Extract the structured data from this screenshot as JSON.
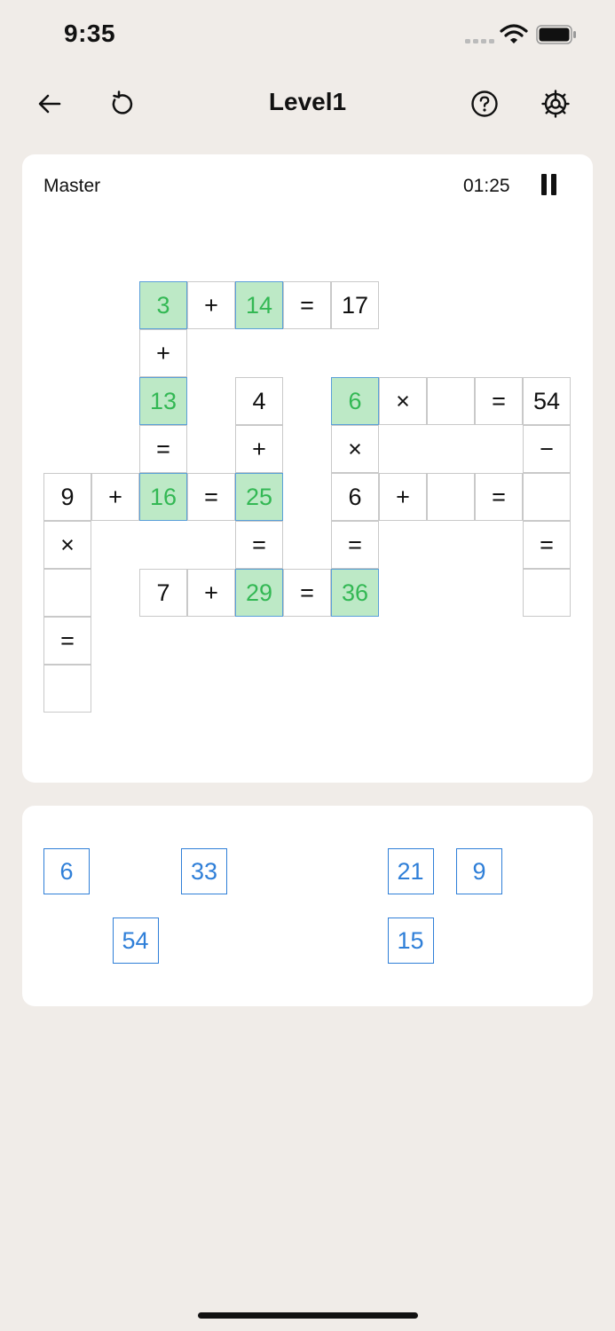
{
  "status": {
    "time": "9:35"
  },
  "header": {
    "title": "Level1"
  },
  "game": {
    "difficulty": "Master",
    "timer": "01:25"
  },
  "grid": [
    {
      "r": 0,
      "c": 2,
      "v": "3",
      "filled": true
    },
    {
      "r": 0,
      "c": 3,
      "v": "+"
    },
    {
      "r": 0,
      "c": 4,
      "v": "14",
      "filled": true
    },
    {
      "r": 0,
      "c": 5,
      "v": "="
    },
    {
      "r": 0,
      "c": 6,
      "v": "17"
    },
    {
      "r": 1,
      "c": 2,
      "v": "+"
    },
    {
      "r": 2,
      "c": 2,
      "v": "13",
      "filled": true
    },
    {
      "r": 2,
      "c": 4,
      "v": "4"
    },
    {
      "r": 2,
      "c": 6,
      "v": "6",
      "filled": true
    },
    {
      "r": 2,
      "c": 7,
      "v": "×"
    },
    {
      "r": 2,
      "c": 8,
      "v": "",
      "empty": true
    },
    {
      "r": 2,
      "c": 9,
      "v": "="
    },
    {
      "r": 2,
      "c": 10,
      "v": "54"
    },
    {
      "r": 3,
      "c": 2,
      "v": "="
    },
    {
      "r": 3,
      "c": 4,
      "v": "+"
    },
    {
      "r": 3,
      "c": 6,
      "v": "×"
    },
    {
      "r": 3,
      "c": 10,
      "v": "−"
    },
    {
      "r": 4,
      "c": 0,
      "v": "9"
    },
    {
      "r": 4,
      "c": 1,
      "v": "+"
    },
    {
      "r": 4,
      "c": 2,
      "v": "16",
      "filled": true
    },
    {
      "r": 4,
      "c": 3,
      "v": "="
    },
    {
      "r": 4,
      "c": 4,
      "v": "25",
      "filled": true
    },
    {
      "r": 4,
      "c": 6,
      "v": "6"
    },
    {
      "r": 4,
      "c": 7,
      "v": "+"
    },
    {
      "r": 4,
      "c": 8,
      "v": "",
      "empty": true
    },
    {
      "r": 4,
      "c": 9,
      "v": "="
    },
    {
      "r": 4,
      "c": 10,
      "v": "",
      "empty": true
    },
    {
      "r": 5,
      "c": 0,
      "v": "×"
    },
    {
      "r": 5,
      "c": 4,
      "v": "="
    },
    {
      "r": 5,
      "c": 6,
      "v": "="
    },
    {
      "r": 5,
      "c": 10,
      "v": "="
    },
    {
      "r": 6,
      "c": 0,
      "v": "",
      "empty": true
    },
    {
      "r": 6,
      "c": 2,
      "v": "7"
    },
    {
      "r": 6,
      "c": 3,
      "v": "+"
    },
    {
      "r": 6,
      "c": 4,
      "v": "29",
      "filled": true
    },
    {
      "r": 6,
      "c": 5,
      "v": "="
    },
    {
      "r": 6,
      "c": 6,
      "v": "36",
      "filled": true
    },
    {
      "r": 6,
      "c": 10,
      "v": "",
      "empty": true
    },
    {
      "r": 7,
      "c": 0,
      "v": "="
    },
    {
      "r": 8,
      "c": 0,
      "v": "",
      "empty": true
    }
  ],
  "tiles": [
    {
      "col": 0,
      "row": 0,
      "v": "6"
    },
    {
      "col": 2,
      "row": 0,
      "v": "33"
    },
    {
      "col": 5,
      "row": 0,
      "v": "21"
    },
    {
      "col": 6,
      "row": 0,
      "v": "9"
    },
    {
      "col": 1,
      "row": 1,
      "v": "54"
    },
    {
      "col": 5,
      "row": 1,
      "v": "15"
    }
  ],
  "icons": {
    "back": "arrow-left-icon",
    "restart": "restart-icon",
    "help": "question-circle-icon",
    "settings": "gear-icon",
    "pause": "pause-icon"
  },
  "colors": {
    "background": "#f0ece8",
    "filled_cell": "#bde9c6",
    "filled_text": "#33b854",
    "tile_blue": "#2f7fd8"
  }
}
